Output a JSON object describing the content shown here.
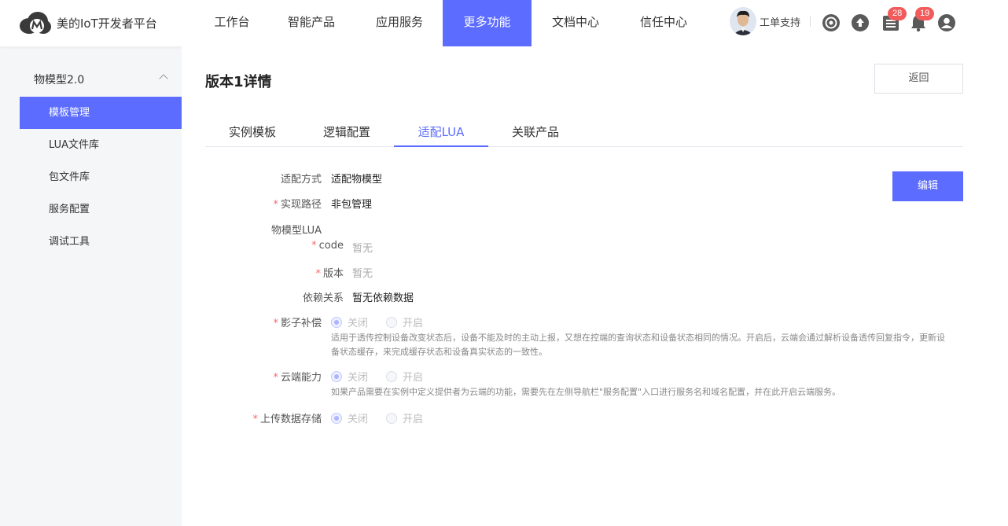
{
  "header": {
    "platform_name": "美的IoT开发者平台",
    "nav": [
      "工作台",
      "智能产品",
      "应用服务",
      "更多功能",
      "文档中心",
      "信任中心"
    ],
    "active_nav": 3,
    "user_label": "工单支持",
    "tasks_badge": "28",
    "notifications_badge": "19"
  },
  "sidebar": {
    "group_label": "物模型2.0",
    "items": [
      "模板管理",
      "LUA文件库",
      "包文件库",
      "服务配置",
      "调试工具"
    ],
    "active_index": 0
  },
  "page": {
    "title": "版本1详情",
    "back_label": "返回",
    "edit_label": "编辑",
    "tabs": [
      "实例模板",
      "逻辑配置",
      "适配LUA",
      "关联产品"
    ],
    "active_tab": 2
  },
  "form": {
    "adapt_mode": {
      "label": "适配方式",
      "value": "适配物模型"
    },
    "impl_path": {
      "label": "实现路径",
      "value": "非包管理"
    },
    "lua_section": "物模型LUA",
    "code": {
      "label": "code",
      "value": "暂无"
    },
    "version": {
      "label": "版本",
      "value": "暂无"
    },
    "dependency": {
      "label": "依赖关系",
      "value": "暂无依赖数据"
    },
    "shadow": {
      "label": "影子补偿",
      "off_label": "关闭",
      "on_label": "开启",
      "hint_line1": "适用于透传控制设备改变状态后，设备不能及时的主动上报，又想在控端的查询状态和设备状态相同的情况。开启后，云端会通过解析设备透传回复指令，更新设",
      "hint_line2": "备状态缓存，来完成缓存状态和设备真实状态的一致性。"
    },
    "cloud": {
      "label": "云端能力",
      "off_label": "关闭",
      "on_label": "开启",
      "hint": "如果产品需要在实例中定义提供者为云端的功能，需要先在左侧导航栏\"服务配置\"入口进行服务名和域名配置，并在此开启云端服务。"
    },
    "upload": {
      "label": "上传数据存储",
      "off_label": "关闭",
      "on_label": "开启"
    }
  }
}
